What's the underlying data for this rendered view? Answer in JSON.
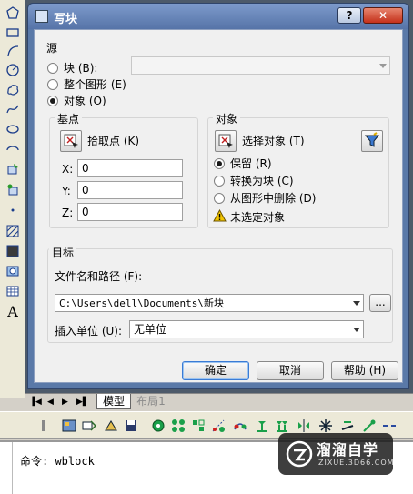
{
  "dialog": {
    "title": "写块",
    "help_glyph": "?",
    "close_glyph": "✕",
    "source": {
      "legend": "源",
      "block_label": "块 (B):",
      "block_value": "",
      "whole_drawing_label": "整个图形 (E)",
      "objects_label": "对象 (O)",
      "selected": "objects"
    },
    "base_point": {
      "legend": "基点",
      "pick_label": "拾取点 (K)",
      "x_label": "X:",
      "x_value": "0",
      "y_label": "Y:",
      "y_value": "0",
      "z_label": "Z:",
      "z_value": "0"
    },
    "objects": {
      "legend": "对象",
      "select_label": "选择对象 (T)",
      "retain_label": "保留 (R)",
      "convert_label": "转换为块 (C)",
      "delete_label": "从图形中删除 (D)",
      "selected": "retain",
      "warning": "未选定对象"
    },
    "destination": {
      "legend": "目标",
      "path_label": "文件名和路径 (F):",
      "path_value": "C:\\Users\\dell\\Documents\\新块",
      "browse_label": "...",
      "units_label": "插入单位 (U):",
      "units_value": "无单位"
    },
    "buttons": {
      "ok": "确定",
      "cancel": "取消",
      "help": "帮助 (H)"
    }
  },
  "layout_tabs": {
    "model": "模型",
    "layout1": "布局1"
  },
  "command_line": {
    "prompt": "命令: ",
    "command": "wblock"
  },
  "watermark": {
    "brand": "溜溜自学",
    "url": "ZIXUE.3D66.COM"
  },
  "colors": {
    "title_bar": "#5674a8",
    "dialog_body": "#f0f0f0",
    "accent": "#2a5fb8",
    "warning": "#f2c500"
  }
}
